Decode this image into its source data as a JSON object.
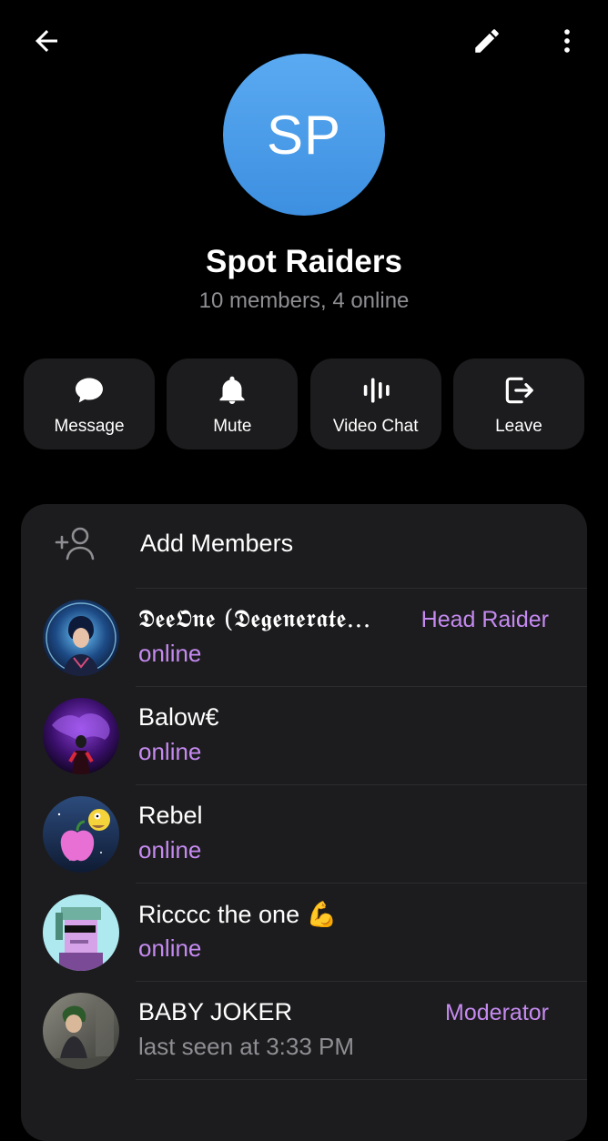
{
  "header": {
    "back_icon": "arrow-left-icon",
    "edit_icon": "pencil-icon",
    "more_icon": "more-vertical-icon"
  },
  "group": {
    "avatar_initials": "SP",
    "avatar_color": "#4a9ce8",
    "name": "Spot Raiders",
    "subtitle": "10 members, 4 online"
  },
  "actions": [
    {
      "label": "Message",
      "icon": "chat-bubble-icon"
    },
    {
      "label": "Mute",
      "icon": "bell-icon"
    },
    {
      "label": "Video Chat",
      "icon": "voice-bars-icon"
    },
    {
      "label": "Leave",
      "icon": "logout-icon"
    }
  ],
  "add_members": {
    "label": "Add Members",
    "icon": "add-person-icon"
  },
  "members": [
    {
      "name": "𝕯𝖊𝖊𝕺𝖓𝖊 (𝕯𝖊𝖌𝖊𝖓𝖊𝖗𝖆𝖙𝖊...",
      "status": "online",
      "role": "Head Raider"
    },
    {
      "name": "Balow€",
      "status": "online",
      "role": ""
    },
    {
      "name": "Rebel",
      "status": "online",
      "role": ""
    },
    {
      "name": "Ricccc the one 💪",
      "status": "online",
      "role": ""
    },
    {
      "name": "BABY JOKER",
      "status": "last seen at 3:33 PM",
      "role": "Moderator"
    }
  ],
  "colors": {
    "background": "#000000",
    "card": "#1c1c1e",
    "accent": "#c58af0",
    "secondary_text": "#8e8e93"
  }
}
